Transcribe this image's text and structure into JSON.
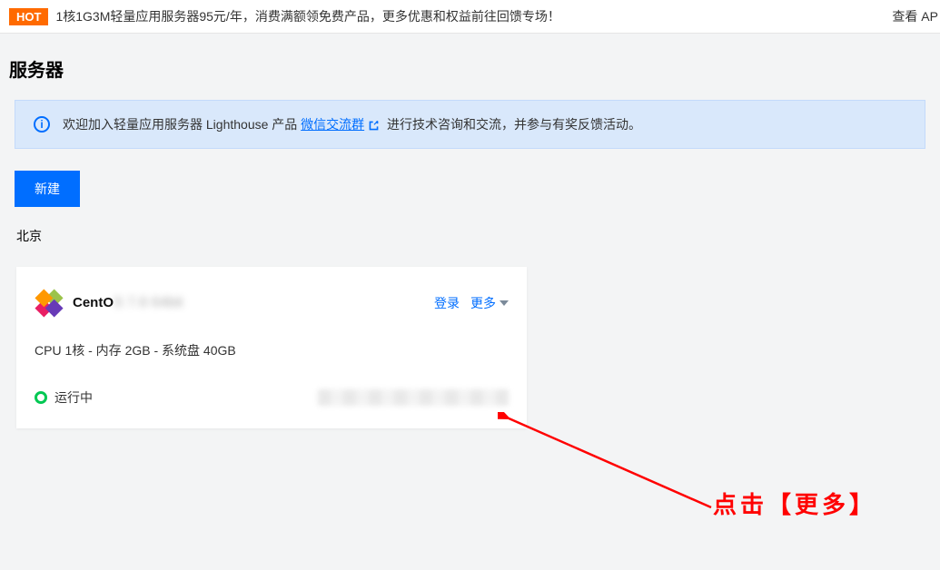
{
  "banner": {
    "hot_badge": "HOT",
    "text": "1核1G3M轻量应用服务器95元/年，消费满额领免费产品，更多优惠和权益前往回馈专场！",
    "right_action": "查看 AP"
  },
  "page_title": "服务器",
  "alert": {
    "pre": "欢迎加入轻量应用服务器 Lighthouse 产品 ",
    "link": "微信交流群",
    "post": " 进行技术咨询和交流，并参与有奖反馈活动。"
  },
  "new_button": "新建",
  "region": "北京",
  "server": {
    "os_name": "CentO",
    "login_action": "登录",
    "more_action": "更多",
    "spec": "CPU 1核 - 内存 2GB - 系统盘 40GB",
    "status": "运行中"
  },
  "annotation": "点击【更多】"
}
